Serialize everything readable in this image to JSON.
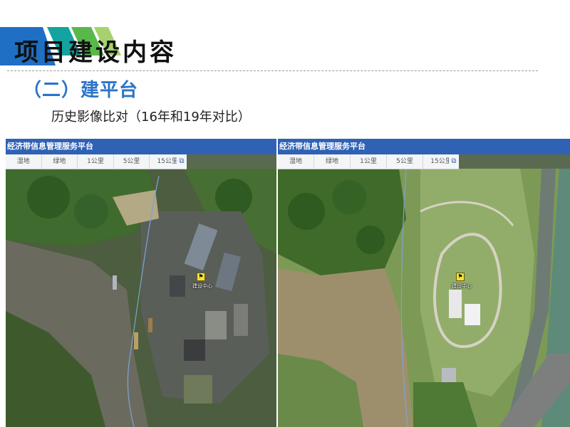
{
  "slide": {
    "title": "项目建设内容",
    "section": "（二）建平台",
    "subtitle": "历史影像比对（16年和19年对比）"
  },
  "colors": {
    "accent_blue": "#2b74c7",
    "header_bar": "#2f62b4",
    "deco_blue": "#1f6fc5",
    "deco_teal": "#14a3a0",
    "deco_green": "#58b84a",
    "marker_yellow": "#f2e23a"
  },
  "panels": [
    {
      "id": "left",
      "header_title": "经济带信息管理服务平台",
      "tabs": [
        "湿地",
        "绿地",
        "1公里",
        "5公里",
        "15公里"
      ],
      "layer_icon": "layers-icon",
      "marker_label": "建设中心"
    },
    {
      "id": "right",
      "header_title": "经济带信息管理服务平台",
      "tabs": [
        "湿地",
        "绿地",
        "1公里",
        "5公里",
        "15公里"
      ],
      "layer_icon": "layers-icon",
      "marker_label": "建设中心"
    }
  ]
}
